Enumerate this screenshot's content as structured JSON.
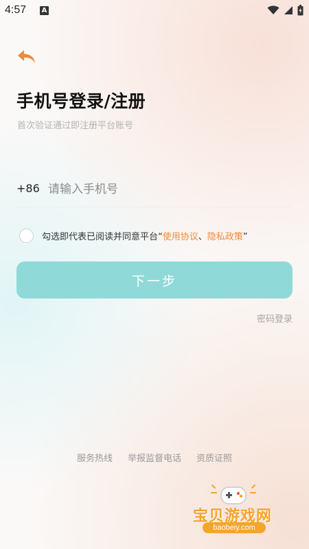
{
  "status_bar": {
    "time": "4:57",
    "notification_letter": "A",
    "icons": [
      "wifi-icon",
      "signal-icon",
      "battery-icon"
    ]
  },
  "header": {
    "back_icon": "back-arrow-icon",
    "title": "手机号登录/注册",
    "subtitle": "首次验证通过即注册平台账号"
  },
  "phone": {
    "country_code": "+86",
    "placeholder": "请输入手机号",
    "value": ""
  },
  "agreement": {
    "checked": false,
    "prefix": "勾选即代表已阅读并同意平台",
    "open_quote": "“",
    "terms_link": "使用协议",
    "separator": "、",
    "privacy_link": "隐私政策",
    "close_quote": "”"
  },
  "actions": {
    "next_label": "下一步",
    "password_login": "密码登录"
  },
  "footer": {
    "links": [
      "服务热线",
      "举报监督电话",
      "资质证照"
    ]
  },
  "watermark": {
    "text": "宝贝游戏网",
    "url": "baobeiy.com"
  },
  "colors": {
    "accent_orange": "#f08a3c",
    "button_teal": "#8fdad8",
    "watermark_orange": "#f3a52d"
  }
}
